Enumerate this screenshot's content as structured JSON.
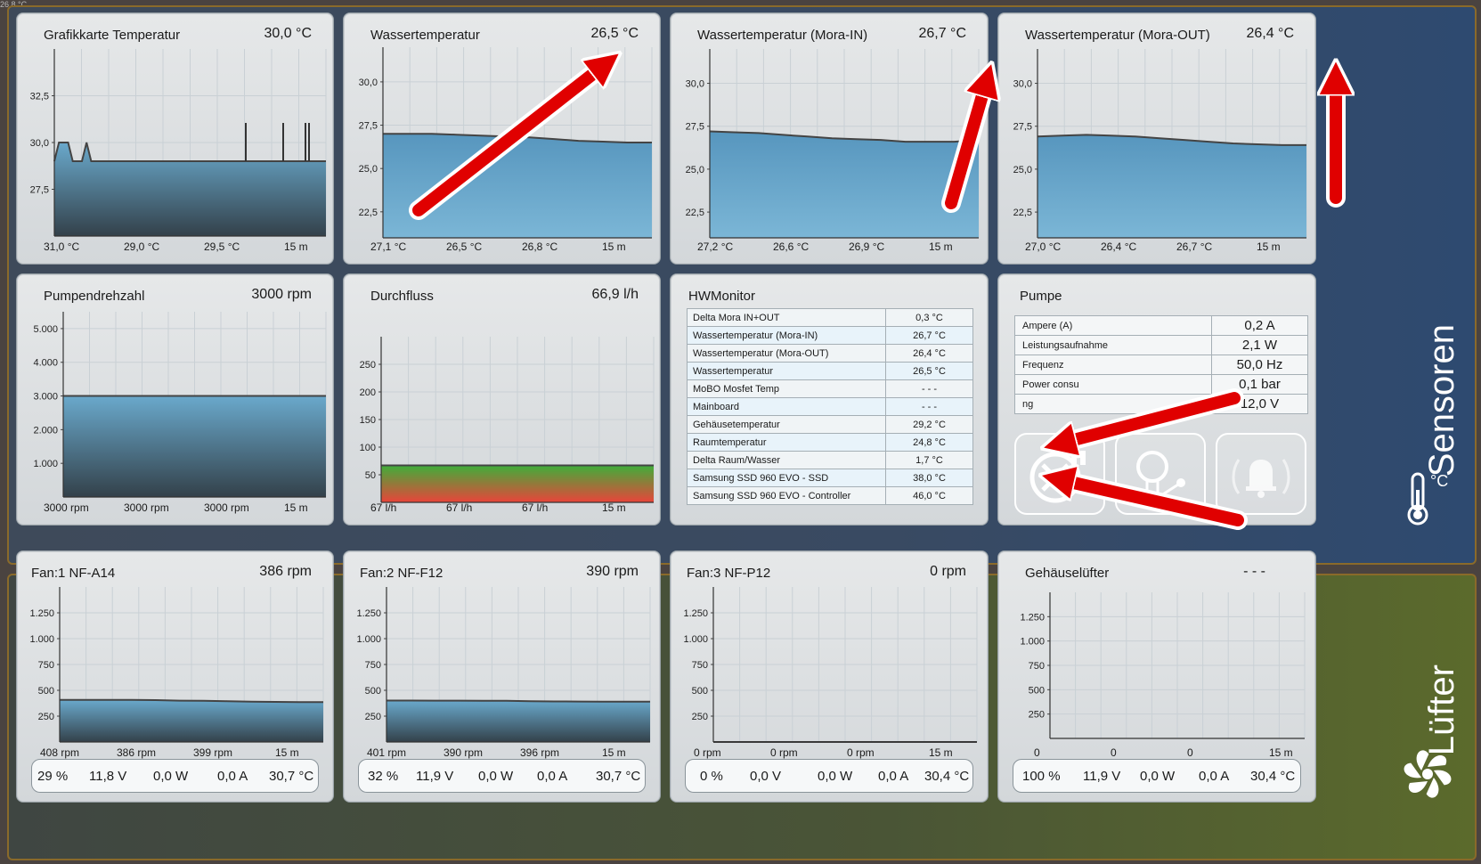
{
  "corner_text": "26,8 °C",
  "sections": {
    "sensors": "Sensoren",
    "fans": "Lüfter"
  },
  "colors": {
    "series_blue": "#6aa9cc",
    "series_line": "#555555",
    "arrow": "#e00000"
  },
  "icons": {
    "thermometer": "thermometer-icon",
    "fan": "fan-icon"
  },
  "panels": {
    "gpu": {
      "title": "Grafikkarte Temperatur",
      "value": "30,0 °C",
      "stats": {
        "max": "31,0 °C",
        "min": "29,0 °C",
        "avg": "29,5 °C",
        "range": "15 m"
      }
    },
    "water": {
      "title": "Wassertemperatur",
      "value": "26,5 °C",
      "stats": {
        "max": "27,1 °C",
        "min": "26,5 °C",
        "avg": "26,8 °C",
        "range": "15 m"
      }
    },
    "mora_in": {
      "title": "Wassertemperatur (Mora-IN)",
      "value": "26,7 °C",
      "stats": {
        "max": "27,2 °C",
        "min": "26,6 °C",
        "avg": "26,9 °C",
        "range": "15 m"
      }
    },
    "mora_out": {
      "title": "Wassertemperatur (Mora-OUT)",
      "value": "26,4 °C",
      "stats": {
        "max": "27,0 °C",
        "min": "26,4 °C",
        "avg": "26,7 °C",
        "range": "15 m"
      }
    },
    "pump_rpm": {
      "title": "Pumpendrehzahl",
      "value": "3000 rpm",
      "stats": {
        "max": "3000 rpm",
        "min": "3000 rpm",
        "avg": "3000 rpm",
        "range": "15 m"
      }
    },
    "flow": {
      "title": "Durchfluss",
      "value": "66,9 l/h",
      "stats": {
        "max": "67 l/h",
        "min": "67 l/h",
        "avg": "67 l/h",
        "range": "15 m"
      }
    },
    "fan1": {
      "title": "Fan:1 NF-A14",
      "value": "386 rpm",
      "stats": {
        "max": "408 rpm",
        "min": "386 rpm",
        "avg": "399 rpm",
        "range": "15 m"
      },
      "bar": {
        "pct": "29 %",
        "volt": "11,8 V",
        "watt": "0,0 W",
        "amp": "0,0 A",
        "temp": "30,7 °C"
      }
    },
    "fan2": {
      "title": "Fan:2 NF-F12",
      "value": "390 rpm",
      "stats": {
        "max": "401 rpm",
        "min": "390 rpm",
        "avg": "396 rpm",
        "range": "15 m"
      },
      "bar": {
        "pct": "32 %",
        "volt": "11,9 V",
        "watt": "0,0 W",
        "amp": "0,0 A",
        "temp": "30,7 °C"
      }
    },
    "fan3": {
      "title": "Fan:3 NF-P12",
      "value": "0 rpm",
      "stats": {
        "max": "0 rpm",
        "min": "0 rpm",
        "avg": "0 rpm",
        "range": "15 m"
      },
      "bar": {
        "pct": "0 %",
        "volt": "0,0 V",
        "watt": "0,0 W",
        "amp": "0,0 A",
        "temp": "30,4 °C"
      }
    },
    "case_fan": {
      "title": "Gehäuselüfter",
      "value": "- - -",
      "stats": {
        "max": "0",
        "min": "0",
        "avg": "0",
        "range": "15 m"
      },
      "bar": {
        "pct": "100 %",
        "volt": "11,9 V",
        "watt": "0,0 W",
        "amp": "0,0 A",
        "temp": "30,4 °C"
      }
    }
  },
  "hwmonitor": {
    "title": "HWMonitor",
    "rows": [
      {
        "label": "Delta Mora IN+OUT",
        "value": "0,3 °C"
      },
      {
        "label": "Wassertemperatur (Mora-IN)",
        "value": "26,7 °C"
      },
      {
        "label": "Wassertemperatur (Mora-OUT)",
        "value": "26,4 °C"
      },
      {
        "label": "Wassertemperatur",
        "value": "26,5 °C"
      },
      {
        "label": "MoBO Mosfet Temp",
        "value": "- - -"
      },
      {
        "label": "Mainboard",
        "value": "- - -"
      },
      {
        "label": "Gehäusetemperatur",
        "value": "29,2 °C"
      },
      {
        "label": "Raumtemperatur",
        "value": "24,8 °C"
      },
      {
        "label": "Delta Raum/Wasser",
        "value": "1,7 °C"
      },
      {
        "label": "Samsung SSD 960 EVO - SSD",
        "value": "38,0 °C"
      },
      {
        "label": "Samsung SSD 960 EVO - Controller",
        "value": "46,0 °C"
      }
    ]
  },
  "pump": {
    "title": "Pumpe",
    "rows": [
      {
        "label": "Ampere (A)",
        "value": "0,2 A"
      },
      {
        "label": "Leistungsaufnahme",
        "value": "2,1 W"
      },
      {
        "label": "Frequenz",
        "value": "50,0 Hz"
      },
      {
        "label": "Power consu",
        "value": "0,1 bar"
      },
      {
        "label": "ng",
        "value": "12,0 V"
      }
    ],
    "buttons": [
      "pump-off-icon",
      "light-switch-icon",
      "alarm-bell-icon"
    ]
  },
  "chart_data": [
    {
      "id": "gpu",
      "type": "area",
      "y_ticks": [
        "32,5",
        "30,0",
        "27,5"
      ],
      "ylim": [
        25,
        35
      ],
      "values": [
        29.0,
        30.0,
        30.0,
        30.0,
        29.0,
        29.0,
        29.0,
        30.0,
        29.0,
        29.0,
        29.0,
        29.0,
        29.0,
        29.0,
        29.0,
        29.0,
        29.0,
        29.0,
        29.0,
        29.0,
        29.0,
        29.0,
        29.0,
        29.0,
        29.0,
        29.0,
        29.0,
        29.0,
        29.0,
        29.0,
        29.0,
        29.0,
        29.0,
        29.0,
        29.0,
        29.0,
        29.0,
        29.0,
        29.0,
        29.0,
        29.0,
        29.0,
        29.0,
        29.0,
        29.0,
        29.0,
        29.0,
        29.0,
        29.0,
        29.0,
        29.0,
        29.0,
        29.0,
        29.0,
        29.0,
        29.0,
        29.0,
        29.0,
        29.0,
        29.0
      ]
    },
    {
      "id": "water",
      "type": "area",
      "y_ticks": [
        "30,0",
        "27,5",
        "25,0",
        "22,5"
      ],
      "ylim": [
        21,
        32
      ],
      "values": [
        27.0,
        27.0,
        27.0,
        26.95,
        26.9,
        26.85,
        26.8,
        26.7,
        26.6,
        26.55,
        26.5,
        26.5
      ]
    },
    {
      "id": "mora_in",
      "type": "area",
      "y_ticks": [
        "30,0",
        "27,5",
        "25,0",
        "22,5"
      ],
      "ylim": [
        21,
        32
      ],
      "values": [
        27.2,
        27.15,
        27.1,
        27.0,
        26.9,
        26.8,
        26.75,
        26.7,
        26.6,
        26.6,
        26.6,
        26.7
      ]
    },
    {
      "id": "mora_out",
      "type": "area",
      "y_ticks": [
        "30,0",
        "27,5",
        "25,0",
        "22,5"
      ],
      "ylim": [
        21,
        32
      ],
      "values": [
        26.9,
        26.95,
        27.0,
        26.95,
        26.9,
        26.8,
        26.7,
        26.6,
        26.5,
        26.45,
        26.4,
        26.4
      ]
    },
    {
      "id": "pump_rpm",
      "type": "area",
      "y_ticks": [
        "5.000",
        "4.000",
        "3.000",
        "2.000",
        "1.000"
      ],
      "ylim": [
        0,
        5500
      ],
      "values": [
        3000,
        3000,
        3000,
        3000,
        3000
      ]
    },
    {
      "id": "flow",
      "type": "area",
      "y_ticks": [
        "250",
        "200",
        "150",
        "100",
        "50"
      ],
      "ylim": [
        0,
        300
      ],
      "values": [
        67,
        67,
        67,
        67,
        67
      ]
    },
    {
      "id": "fan1",
      "type": "area",
      "y_ticks": [
        "1.250",
        "1.000",
        "750",
        "500",
        "250"
      ],
      "ylim": [
        0,
        1500
      ],
      "values": [
        408,
        408,
        408,
        408,
        405,
        400,
        399,
        395,
        390,
        388,
        386,
        386
      ]
    },
    {
      "id": "fan2",
      "type": "area",
      "y_ticks": [
        "1.250",
        "1.000",
        "750",
        "500",
        "250"
      ],
      "ylim": [
        0,
        1500
      ],
      "values": [
        401,
        401,
        400,
        400,
        399,
        398,
        395,
        392,
        391,
        390,
        390,
        390
      ]
    },
    {
      "id": "fan3",
      "type": "area",
      "y_ticks": [
        "1.250",
        "1.000",
        "750",
        "500",
        "250"
      ],
      "ylim": [
        0,
        1500
      ],
      "values": [
        0,
        0,
        0,
        0,
        0
      ]
    },
    {
      "id": "case_fan",
      "type": "area",
      "y_ticks": [
        "1.250",
        "1.000",
        "750",
        "500",
        "250"
      ],
      "ylim": [
        0,
        1500
      ],
      "values": []
    }
  ]
}
